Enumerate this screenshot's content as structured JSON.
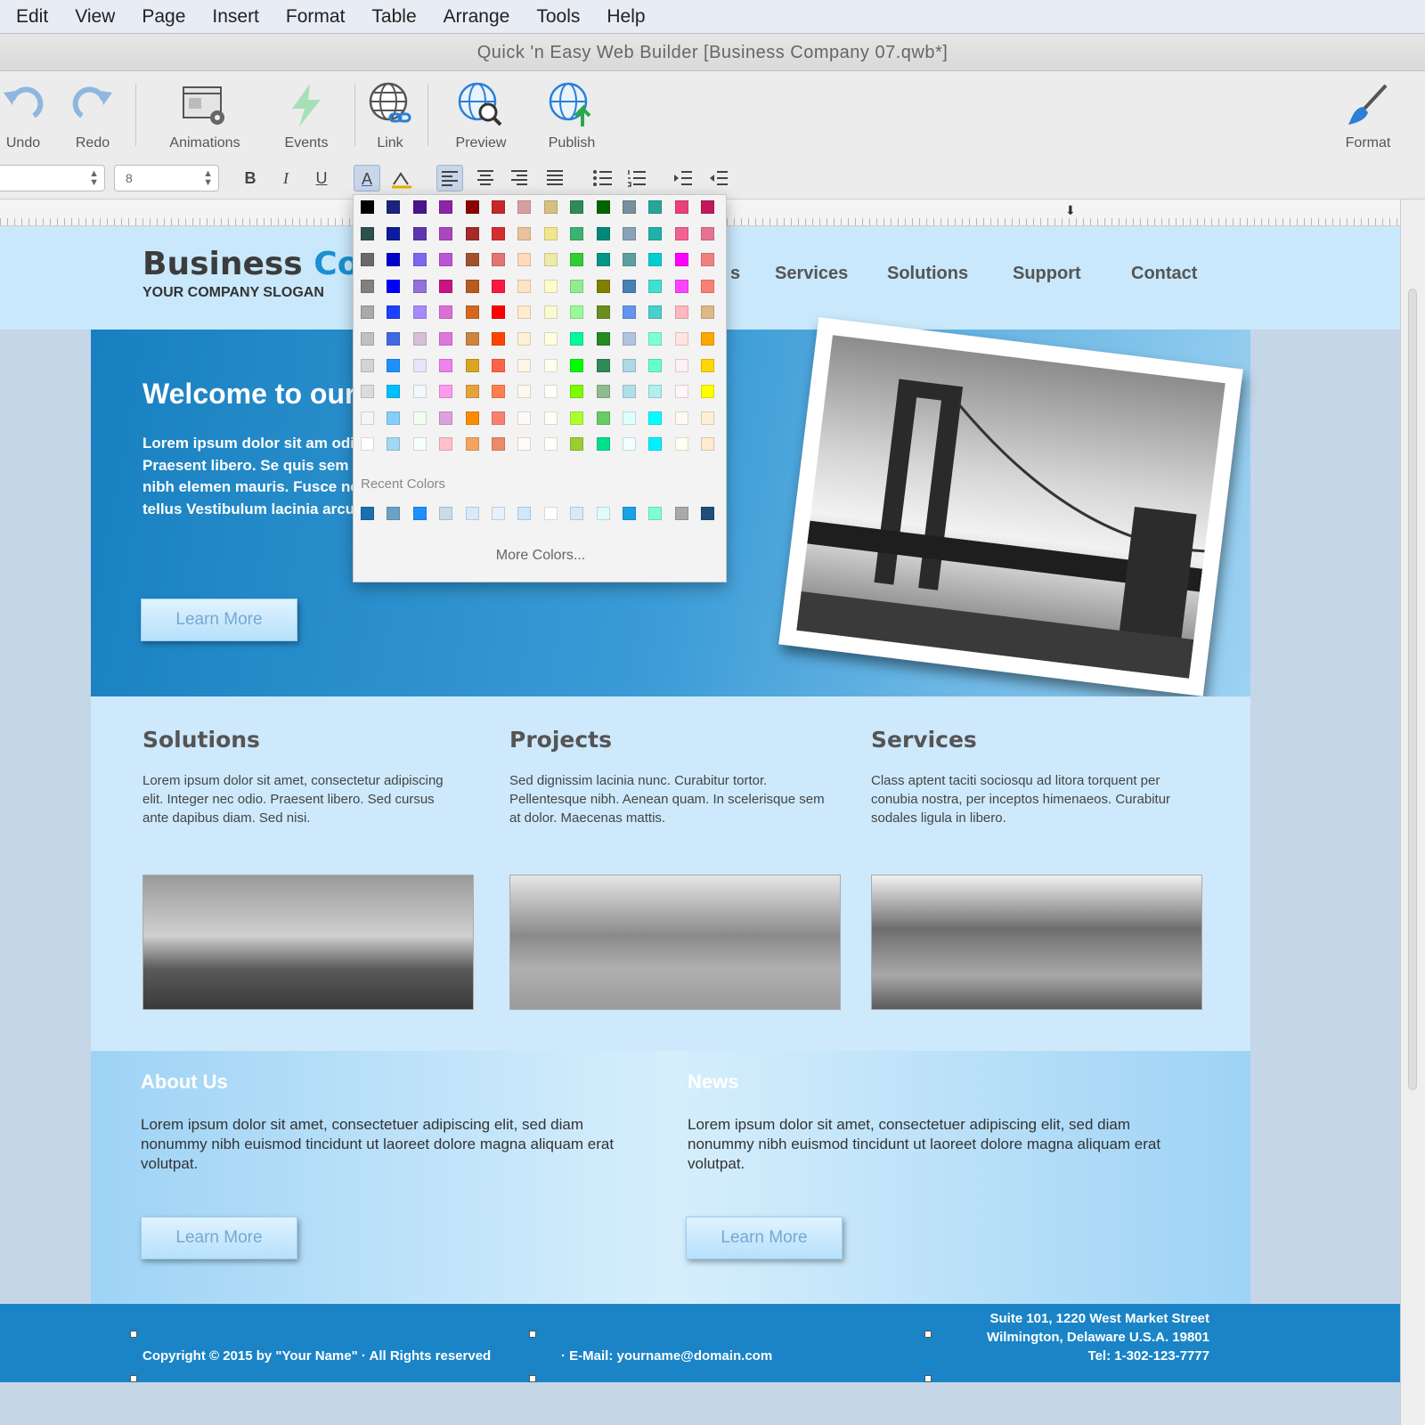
{
  "menu": [
    "Edit",
    "View",
    "Page",
    "Insert",
    "Format",
    "Table",
    "Arrange",
    "Tools",
    "Help"
  ],
  "window_title": "Quick 'n Easy Web Builder [Business Company 07.qwb*]",
  "toolbar": {
    "undo": "Undo",
    "redo": "Redo",
    "animations": "Animations",
    "events": "Events",
    "link": "Link",
    "preview": "Preview",
    "publish": "Publish",
    "format": "Format"
  },
  "formatbar": {
    "font_size_value": "8"
  },
  "site": {
    "brand_part1": "Business ",
    "brand_part2": "Com",
    "slogan": "YOUR COMPANY SLOGAN",
    "nav": [
      "s",
      "Services",
      "Solutions",
      "Support",
      "Contact"
    ],
    "hero_title": "Welcome to our",
    "hero_text": "Lorem ipsum dolor sit am odio. Praesent libero. Se quis sem at nibh elemen mauris. Fusce nec tellus Vestibulum lacinia arcu e",
    "learn_more": "Learn More",
    "columns": [
      {
        "title": "Solutions",
        "text": "Lorem ipsum dolor sit amet, consectetur adipiscing elit. Integer nec odio. Praesent libero. Sed cursus ante dapibus diam. Sed nisi."
      },
      {
        "title": "Projects",
        "text": "Sed dignissim lacinia nunc. Curabitur tortor. Pellentesque nibh. Aenean quam. In scelerisque sem at dolor. Maecenas mattis."
      },
      {
        "title": "Services",
        "text": "Class aptent taciti sociosqu ad litora torquent per conubia nostra, per inceptos himenaeos. Curabitur sodales ligula in libero."
      }
    ],
    "about_title": "About Us",
    "about_text": "Lorem ipsum dolor sit amet, consectetuer adipiscing elit, sed diam nonummy nibh euismod tincidunt ut laoreet dolore magna aliquam erat volutpat.",
    "news_title": "News",
    "news_text": "Lorem ipsum dolor sit amet, consectetuer adipiscing elit, sed diam nonummy nibh euismod tincidunt ut laoreet dolore magna aliquam erat volutpat.",
    "footer_copyright": "Copyright © 2015 by \"Your Name\"  ·  All Rights reserved",
    "footer_email": "·  E-Mail: yourname@domain.com",
    "footer_address1": "Suite 101, 1220 West Market Street",
    "footer_address2": "Wilmington, Delaware  U.S.A. 19801",
    "footer_tel": "Tel: 1-302-123-7777"
  },
  "color_picker": {
    "recent_label": "Recent Colors",
    "more_label": "More Colors...",
    "palette_rows": [
      [
        "#000000",
        "#1a237e",
        "#4a148c",
        "#8e24aa",
        "#8b0000",
        "#c62828",
        "#d7a0a0",
        "#d4c080",
        "#2e8b57",
        "#006400",
        "#78909c",
        "#26a69a",
        "#ec407a",
        "#c2185b"
      ],
      [
        "#2f4f4f",
        "#0d1b9e",
        "#5e35b1",
        "#ab47bc",
        "#a52a2a",
        "#d32f2f",
        "#e9c39b",
        "#f0e68c",
        "#3cb371",
        "#00897b",
        "#8aa2b8",
        "#20b2aa",
        "#f06292",
        "#e57390"
      ],
      [
        "#696969",
        "#0000cd",
        "#7b68ee",
        "#ba55d3",
        "#a0522d",
        "#e57373",
        "#ffdab9",
        "#eee8aa",
        "#32cd32",
        "#009688",
        "#5f9ea0",
        "#00ced1",
        "#ff00ff",
        "#f08080"
      ],
      [
        "#808080",
        "#0000ff",
        "#9370db",
        "#c71585",
        "#b8591e",
        "#ff1744",
        "#ffe4c4",
        "#fffacd",
        "#90ee90",
        "#808000",
        "#4682b4",
        "#40e0d0",
        "#ff44ff",
        "#fa8072"
      ],
      [
        "#a9a9a9",
        "#1e40ff",
        "#a78bfa",
        "#da70d6",
        "#d2691e",
        "#ff0000",
        "#ffebcd",
        "#fafad2",
        "#98fb98",
        "#6b8e23",
        "#6495ed",
        "#48d1cc",
        "#ffb6c1",
        "#deb887"
      ],
      [
        "#c0c0c0",
        "#4169e1",
        "#d8bfd8",
        "#dd77dd",
        "#cd853f",
        "#ff4500",
        "#fff0d5",
        "#ffffe0",
        "#00fa9a",
        "#228b22",
        "#b0c4de",
        "#7fffd4",
        "#ffe4e1",
        "#ffa500"
      ],
      [
        "#d3d3d3",
        "#1e90ff",
        "#e6e6fa",
        "#ee82ee",
        "#daa520",
        "#ff6347",
        "#fff5e6",
        "#fffff0",
        "#00ff00",
        "#2e8b57",
        "#add8e6",
        "#66ffcc",
        "#fff0f5",
        "#ffd700"
      ],
      [
        "#dcdcdc",
        "#00bfff",
        "#f0f8ff",
        "#ff99ee",
        "#e6a23c",
        "#ff7f50",
        "#fff8f0",
        "#fffffa",
        "#7cfc00",
        "#8fbc8f",
        "#b0e0e6",
        "#afeeee",
        "#fff5fa",
        "#ffff00"
      ],
      [
        "#f5f5f5",
        "#87cefa",
        "#f0fff0",
        "#dda0dd",
        "#ff8c00",
        "#fa8072",
        "#fffaf5",
        "#fffff5",
        "#adff2f",
        "#66cc66",
        "#e0ffff",
        "#00ffff",
        "#fffaf0",
        "#ffefd5"
      ],
      [
        "#ffffff",
        "#a4d8f0",
        "#f5fffa",
        "#ffc0cb",
        "#f4a460",
        "#f08866",
        "#fffaf8",
        "#fffffc",
        "#9acd32",
        "#00e08a",
        "#f0ffff",
        "#00f0ff",
        "#fffff0",
        "#ffebcd"
      ]
    ],
    "recent_colors": [
      "#1a6fb0",
      "#6ba3c7",
      "#1e90ff",
      "#c9dce8",
      "#d8eafa",
      "#e6f1fb",
      "#d0e8fb",
      "#ffffff",
      "#dbe8f8",
      "#e0fbfb",
      "#16a3e8",
      "#7fffd4",
      "#a9a9a9",
      "#1e4f7a"
    ]
  }
}
